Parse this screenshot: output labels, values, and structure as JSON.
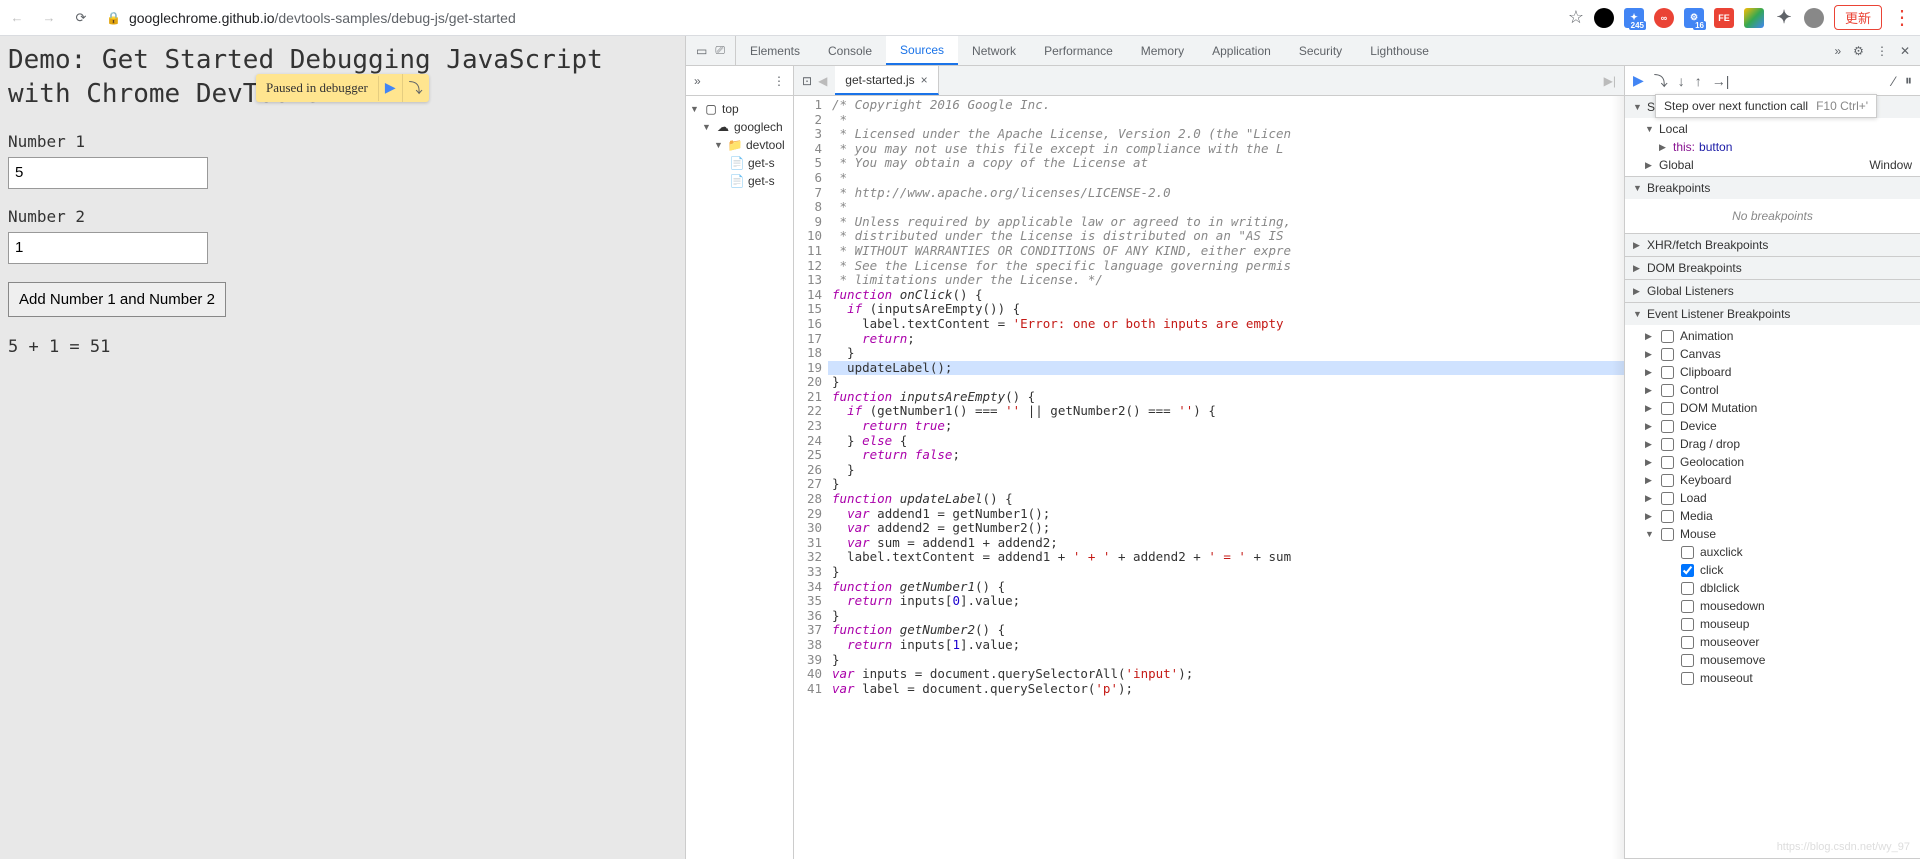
{
  "browser": {
    "url_host": "googlechrome.github.io",
    "url_path": "/devtools-samples/debug-js/get-started",
    "star": "☆",
    "ext_badge": "245",
    "ext_badge2": "16",
    "update_label": "更新"
  },
  "page": {
    "title": "Demo: Get Started Debugging JavaScript with Chrome DevTools",
    "label1": "Number 1",
    "value1": "5",
    "label2": "Number 2",
    "value2": "1",
    "button": "Add Number 1 and Number 2",
    "result": "5 + 1 = 51"
  },
  "paused": {
    "text": "Paused in debugger"
  },
  "devtools": {
    "tabs": [
      "Elements",
      "Console",
      "Sources",
      "Network",
      "Performance",
      "Memory",
      "Application",
      "Security",
      "Lighthouse"
    ],
    "active_tab": "Sources",
    "navigator": {
      "top": "top",
      "domain_icon": "☁",
      "domain": "googlech",
      "folder": "devtool",
      "file1": "get-s",
      "file2": "get-s"
    },
    "editor": {
      "tab": "get-started.js",
      "hl_line": 19,
      "code": [
        {
          "n": 1,
          "t": "/* Copyright 2016 Google Inc.",
          "c": "cm"
        },
        {
          "n": 2,
          "t": " *",
          "c": "cm"
        },
        {
          "n": 3,
          "t": " * Licensed under the Apache License, Version 2.0 (the \"Licen",
          "c": "cm"
        },
        {
          "n": 4,
          "t": " * you may not use this file except in compliance with the L",
          "c": "cm"
        },
        {
          "n": 5,
          "t": " * You may obtain a copy of the License at",
          "c": "cm"
        },
        {
          "n": 6,
          "t": " *",
          "c": "cm"
        },
        {
          "n": 7,
          "t": " * http://www.apache.org/licenses/LICENSE-2.0",
          "c": "cm"
        },
        {
          "n": 8,
          "t": " *",
          "c": "cm"
        },
        {
          "n": 9,
          "t": " * Unless required by applicable law or agreed to in writing,",
          "c": "cm"
        },
        {
          "n": 10,
          "t": " * distributed under the License is distributed on an \"AS IS",
          "c": "cm"
        },
        {
          "n": 11,
          "t": " * WITHOUT WARRANTIES OR CONDITIONS OF ANY KIND, either expre",
          "c": "cm"
        },
        {
          "n": 12,
          "t": " * See the License for the specific language governing permis",
          "c": "cm"
        },
        {
          "n": 13,
          "t": " * limitations under the License. */",
          "c": "cm"
        },
        {
          "n": 14,
          "html": "<span class='kw'>function</span> <span class='fn'>onClick</span>() {"
        },
        {
          "n": 15,
          "html": "  <span class='kw'>if</span> (inputsAreEmpty()) {"
        },
        {
          "n": 16,
          "html": "    label.textContent = <span class='str'>'Error: one or both inputs are empty</span>"
        },
        {
          "n": 17,
          "html": "    <span class='kw'>return</span>;"
        },
        {
          "n": 18,
          "t": "  }"
        },
        {
          "n": 19,
          "t": "  updateLabel();"
        },
        {
          "n": 20,
          "t": "}"
        },
        {
          "n": 21,
          "html": "<span class='kw'>function</span> <span class='fn'>inputsAreEmpty</span>() {"
        },
        {
          "n": 22,
          "html": "  <span class='kw'>if</span> (getNumber1() === <span class='str'>''</span> || getNumber2() === <span class='str'>''</span>) {"
        },
        {
          "n": 23,
          "html": "    <span class='kw'>return</span> <span class='kw'>true</span>;"
        },
        {
          "n": 24,
          "html": "  } <span class='kw'>else</span> {"
        },
        {
          "n": 25,
          "html": "    <span class='kw'>return</span> <span class='kw'>false</span>;"
        },
        {
          "n": 26,
          "t": "  }"
        },
        {
          "n": 27,
          "t": "}"
        },
        {
          "n": 28,
          "html": "<span class='kw'>function</span> <span class='fn'>updateLabel</span>() {"
        },
        {
          "n": 29,
          "html": "  <span class='kw'>var</span> addend1 = getNumber1();"
        },
        {
          "n": 30,
          "html": "  <span class='kw'>var</span> addend2 = getNumber2();"
        },
        {
          "n": 31,
          "html": "  <span class='kw'>var</span> sum = addend1 + addend2;"
        },
        {
          "n": 32,
          "html": "  label.textContent = addend1 + <span class='str'>' + '</span> + addend2 + <span class='str'>' = '</span> + sum"
        },
        {
          "n": 33,
          "t": "}"
        },
        {
          "n": 34,
          "html": "<span class='kw'>function</span> <span class='fn'>getNumber1</span>() {"
        },
        {
          "n": 35,
          "html": "  <span class='kw'>return</span> inputs[<span class='num'>0</span>].value;"
        },
        {
          "n": 36,
          "t": "}"
        },
        {
          "n": 37,
          "html": "<span class='kw'>function</span> <span class='fn'>getNumber2</span>() {"
        },
        {
          "n": 38,
          "html": "  <span class='kw'>return</span> inputs[<span class='num'>1</span>].value;"
        },
        {
          "n": 39,
          "t": "}"
        },
        {
          "n": 40,
          "html": "<span class='kw'>var</span> inputs = document.querySelectorAll(<span class='str'>'input'</span>);"
        },
        {
          "n": 41,
          "html": "<span class='kw'>var</span> label = document.querySelector(<span class='str'>'p'</span>);"
        }
      ]
    },
    "tooltip": {
      "text": "Step over next function call",
      "keys": "F10  Ctrl+'"
    },
    "scope": {
      "header": "Scope",
      "local": "Local",
      "this_key": "this:",
      "this_val": "button",
      "global": "Global",
      "global_val": "Window"
    },
    "breakpoints": {
      "header": "Breakpoints",
      "empty": "No breakpoints"
    },
    "panes": {
      "xhr": "XHR/fetch Breakpoints",
      "dom": "DOM Breakpoints",
      "gl": "Global Listeners",
      "el": "Event Listener Breakpoints"
    },
    "events": {
      "categories": [
        "Animation",
        "Canvas",
        "Clipboard",
        "Control",
        "DOM Mutation",
        "Device",
        "Drag / drop",
        "Geolocation",
        "Keyboard",
        "Load",
        "Media",
        "Mouse"
      ],
      "mouse_expanded": true,
      "mouse_items": [
        {
          "label": "auxclick",
          "checked": false
        },
        {
          "label": "click",
          "checked": true
        },
        {
          "label": "dblclick",
          "checked": false
        },
        {
          "label": "mousedown",
          "checked": false
        },
        {
          "label": "mouseup",
          "checked": false
        },
        {
          "label": "mouseover",
          "checked": false
        },
        {
          "label": "mousemove",
          "checked": false
        },
        {
          "label": "mouseout",
          "checked": false
        }
      ]
    },
    "watermark": "https://blog.csdn.net/wy_97"
  }
}
